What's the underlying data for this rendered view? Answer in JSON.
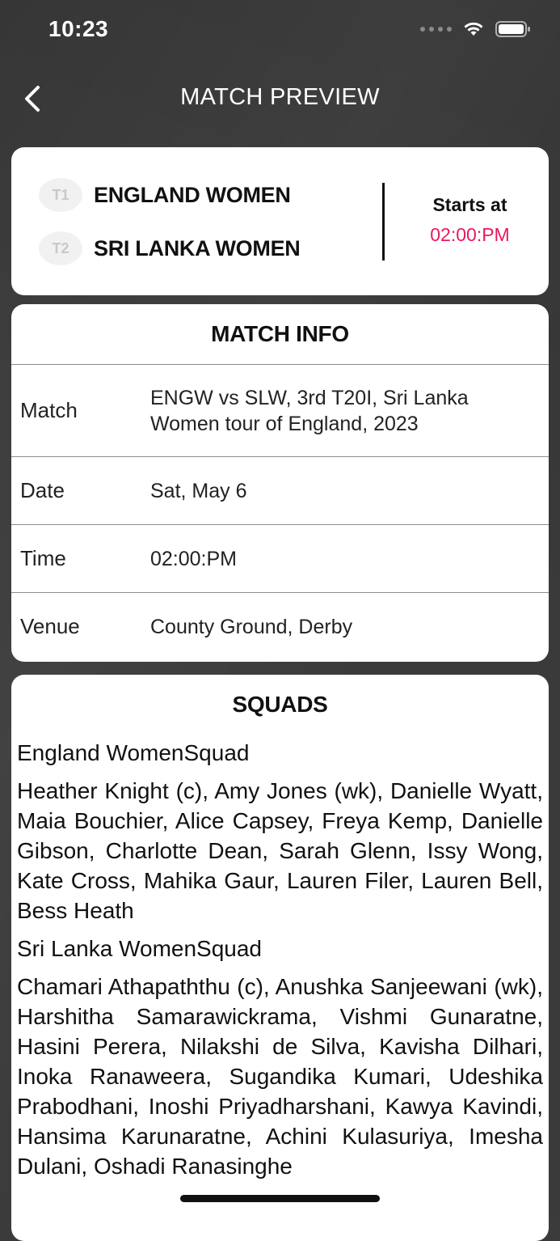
{
  "status_bar": {
    "time": "10:23"
  },
  "header": {
    "title": "MATCH PREVIEW",
    "back_icon": "chevron-left-icon"
  },
  "teams": {
    "team1": {
      "logo_text": "T1",
      "name": "ENGLAND WOMEN"
    },
    "team2": {
      "logo_text": "T2",
      "name": "SRI LANKA WOMEN"
    },
    "starts_label": "Starts at",
    "starts_time": "02:00:PM",
    "accent_color": "#e8195f"
  },
  "match_info": {
    "title": "MATCH INFO",
    "rows": [
      {
        "key": "Match",
        "value": "ENGW vs SLW, 3rd T20I, Sri Lanka Women tour of England, 2023"
      },
      {
        "key": "Date",
        "value": "Sat, May 6"
      },
      {
        "key": "Time",
        "value": "02:00:PM"
      },
      {
        "key": "Venue",
        "value": "County Ground, Derby"
      }
    ]
  },
  "squads": {
    "title": "SQUADS",
    "groups": [
      {
        "name": "England WomenSquad",
        "players": "Heather Knight (c), Amy Jones (wk), Danielle Wyatt, Maia Bouchier, Alice Capsey, Freya Kemp, Danielle Gibson, Charlotte Dean, Sarah Glenn, Issy Wong, Kate Cross, Mahika Gaur, Lauren Filer, Lauren Bell, Bess Heath"
      },
      {
        "name": "Sri Lanka WomenSquad",
        "players": "Chamari Athapaththu (c), Anushka Sanjeewani (wk), Harshitha Samarawickrama, Vishmi Gunaratne, Hasini Perera, Nilakshi de Silva, Kavisha Dilhari, Inoka Ranaweera, Sugandika Kumari, Udeshika Prabodhani, Inoshi Priyadharshani, Kawya Kavindi, Hansima Karunaratne, Achini Kulasuriya, Imesha Dulani, Oshadi Ranasinghe"
      }
    ]
  }
}
